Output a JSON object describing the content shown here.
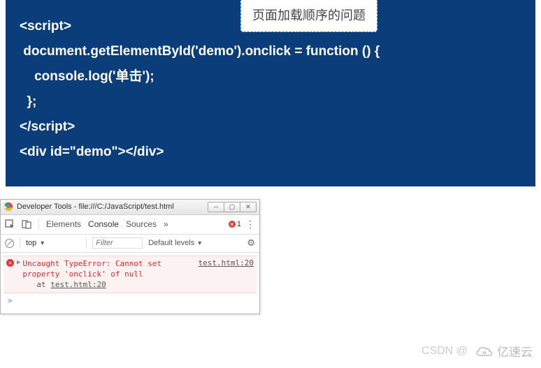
{
  "annotation": "页面加载顺序的问题",
  "code": {
    "line1": "<script>",
    "line2": " document.getElementById('demo').onclick = function () {",
    "line3": "    console.log('单击');",
    "line4": "  };",
    "line5": "</script>",
    "line6": "<div id=\"demo\"></div>"
  },
  "devtools": {
    "title": "Developer Tools - file:///C:/JavaScript/test.html",
    "tabs": {
      "elements": "Elements",
      "console": "Console",
      "sources": "Sources",
      "more": "»"
    },
    "error_count": "1",
    "filterbar": {
      "context": "top",
      "filter_placeholder": "Filter",
      "levels": "Default levels"
    },
    "error": {
      "message": "Uncaught TypeError: Cannot set property 'onclick' of null",
      "at_prefix": "at ",
      "at_file": "test.html:20",
      "link": "test.html:20"
    },
    "prompt": ">"
  },
  "watermark": {
    "csdn": "CSDN @",
    "logo_text": "亿速云"
  }
}
